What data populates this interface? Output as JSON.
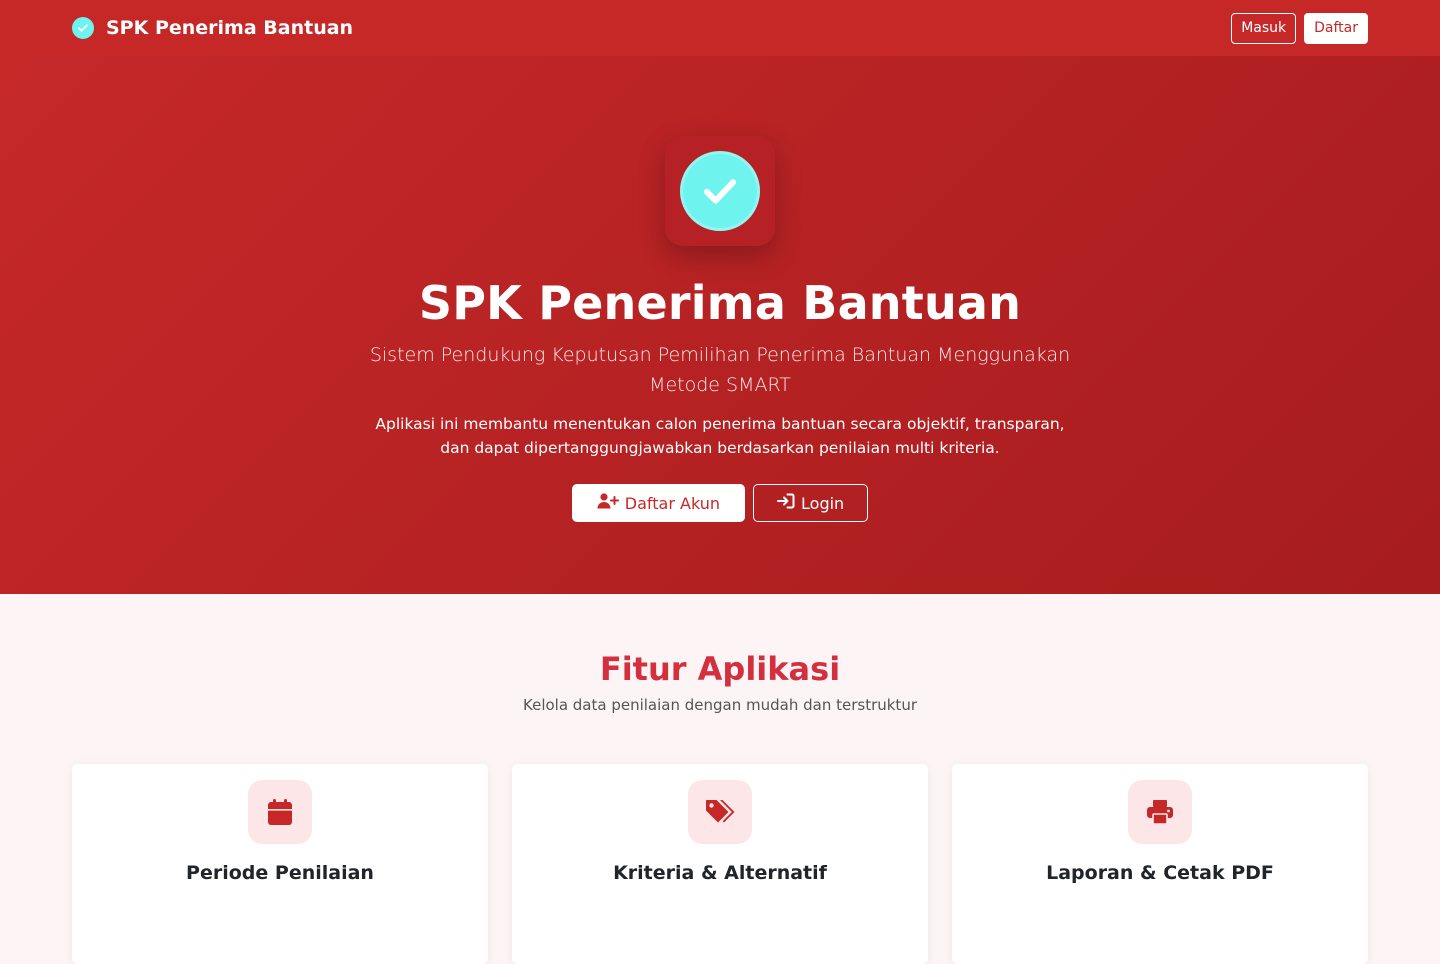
{
  "navbar": {
    "brand": "SPK Penerima Bantuan",
    "masuk_label": "Masuk",
    "daftar_label": "Daftar"
  },
  "hero": {
    "title": "SPK Penerima Bantuan",
    "subtitle": "Sistem Pendukung Keputusan Pemilihan Penerima Bantuan Menggunakan Metode SMART",
    "description": "Aplikasi ini membantu menentukan calon penerima bantuan secara objektif, transparan, dan dapat dipertanggungjawabkan berdasarkan penilaian multi kriteria.",
    "register_label": "Daftar Akun",
    "login_label": "Login"
  },
  "features": {
    "title": "Fitur Aplikasi",
    "subtitle": "Kelola data penilaian dengan mudah dan terstruktur",
    "cards": [
      {
        "icon": "calendar-icon",
        "title": "Periode Penilaian",
        "text": ""
      },
      {
        "icon": "tags-icon",
        "title": "Kriteria & Alternatif",
        "text": ""
      },
      {
        "icon": "printer-icon",
        "title": "Laporan & Cetak PDF",
        "text": ""
      }
    ]
  },
  "colors": {
    "primary": "#c62828",
    "accent": "#6ff3ee",
    "heading": "#d32f3f",
    "icon_bg": "#fde6e7"
  }
}
